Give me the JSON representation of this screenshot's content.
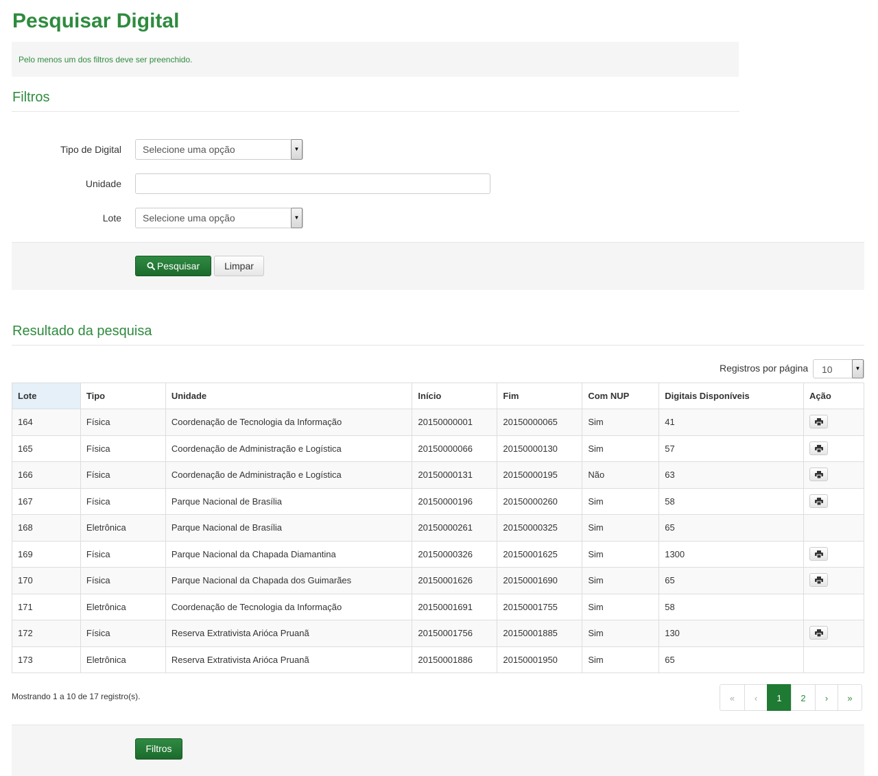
{
  "page_title": "Pesquisar Digital",
  "alert_text": "Pelo menos um dos filtros deve ser preenchido.",
  "filters": {
    "title": "Filtros",
    "tipo_label": "Tipo de Digital",
    "tipo_value": "Selecione uma opção",
    "unidade_label": "Unidade",
    "unidade_value": "",
    "lote_label": "Lote",
    "lote_value": "Selecione uma opção",
    "search_button": "Pesquisar",
    "clear_button": "Limpar"
  },
  "results": {
    "title": "Resultado da pesquisa",
    "per_page_label": "Registros por página",
    "per_page_value": "10",
    "columns": [
      "Lote",
      "Tipo",
      "Unidade",
      "Início",
      "Fim",
      "Com NUP",
      "Digitais Disponíveis",
      "Ação"
    ],
    "rows": [
      {
        "lote": "164",
        "tipo": "Física",
        "unidade": "Coordenação de Tecnologia da Informação",
        "inicio": "20150000001",
        "fim": "20150000065",
        "nup": "Sim",
        "disponiveis": "41",
        "print": true
      },
      {
        "lote": "165",
        "tipo": "Física",
        "unidade": "Coordenação de Administração e Logística",
        "inicio": "20150000066",
        "fim": "20150000130",
        "nup": "Sim",
        "disponiveis": "57",
        "print": true
      },
      {
        "lote": "166",
        "tipo": "Física",
        "unidade": "Coordenação de Administração e Logística",
        "inicio": "20150000131",
        "fim": "20150000195",
        "nup": "Não",
        "disponiveis": "63",
        "print": true
      },
      {
        "lote": "167",
        "tipo": "Física",
        "unidade": "Parque Nacional de Brasília",
        "inicio": "20150000196",
        "fim": "20150000260",
        "nup": "Sim",
        "disponiveis": "58",
        "print": true
      },
      {
        "lote": "168",
        "tipo": "Eletrônica",
        "unidade": "Parque Nacional de Brasília",
        "inicio": "20150000261",
        "fim": "20150000325",
        "nup": "Sim",
        "disponiveis": "65",
        "print": false
      },
      {
        "lote": "169",
        "tipo": "Física",
        "unidade": "Parque Nacional da Chapada Diamantina",
        "inicio": "20150000326",
        "fim": "20150001625",
        "nup": "Sim",
        "disponiveis": "1300",
        "print": true
      },
      {
        "lote": "170",
        "tipo": "Física",
        "unidade": "Parque Nacional da Chapada dos Guimarães",
        "inicio": "20150001626",
        "fim": "20150001690",
        "nup": "Sim",
        "disponiveis": "65",
        "print": true
      },
      {
        "lote": "171",
        "tipo": "Eletrônica",
        "unidade": "Coordenação de Tecnologia da Informação",
        "inicio": "20150001691",
        "fim": "20150001755",
        "nup": "Sim",
        "disponiveis": "58",
        "print": false
      },
      {
        "lote": "172",
        "tipo": "Física",
        "unidade": "Reserva Extrativista Arióca Pruanã",
        "inicio": "20150001756",
        "fim": "20150001885",
        "nup": "Sim",
        "disponiveis": "130",
        "print": true
      },
      {
        "lote": "173",
        "tipo": "Eletrônica",
        "unidade": "Reserva Extrativista Arióca Pruanã",
        "inicio": "20150001886",
        "fim": "20150001950",
        "nup": "Sim",
        "disponiveis": "65",
        "print": false
      }
    ],
    "showing_text": "Mostrando 1 a 10 de 17 registro(s).",
    "pagination": {
      "first": "«",
      "prev": "‹",
      "pages": [
        "1",
        "2"
      ],
      "active_page": "1",
      "next": "›",
      "last": "»"
    }
  },
  "footer_button": "Filtros",
  "icons": {
    "search": "search-icon",
    "print": "print-icon",
    "dropdown": "chevron-down-icon"
  },
  "colors": {
    "brand_green": "#2e8b3e",
    "button_green": "#1f7a33",
    "panel_gray": "#f5f5f5",
    "sorted_header": "#e5f0f8"
  }
}
